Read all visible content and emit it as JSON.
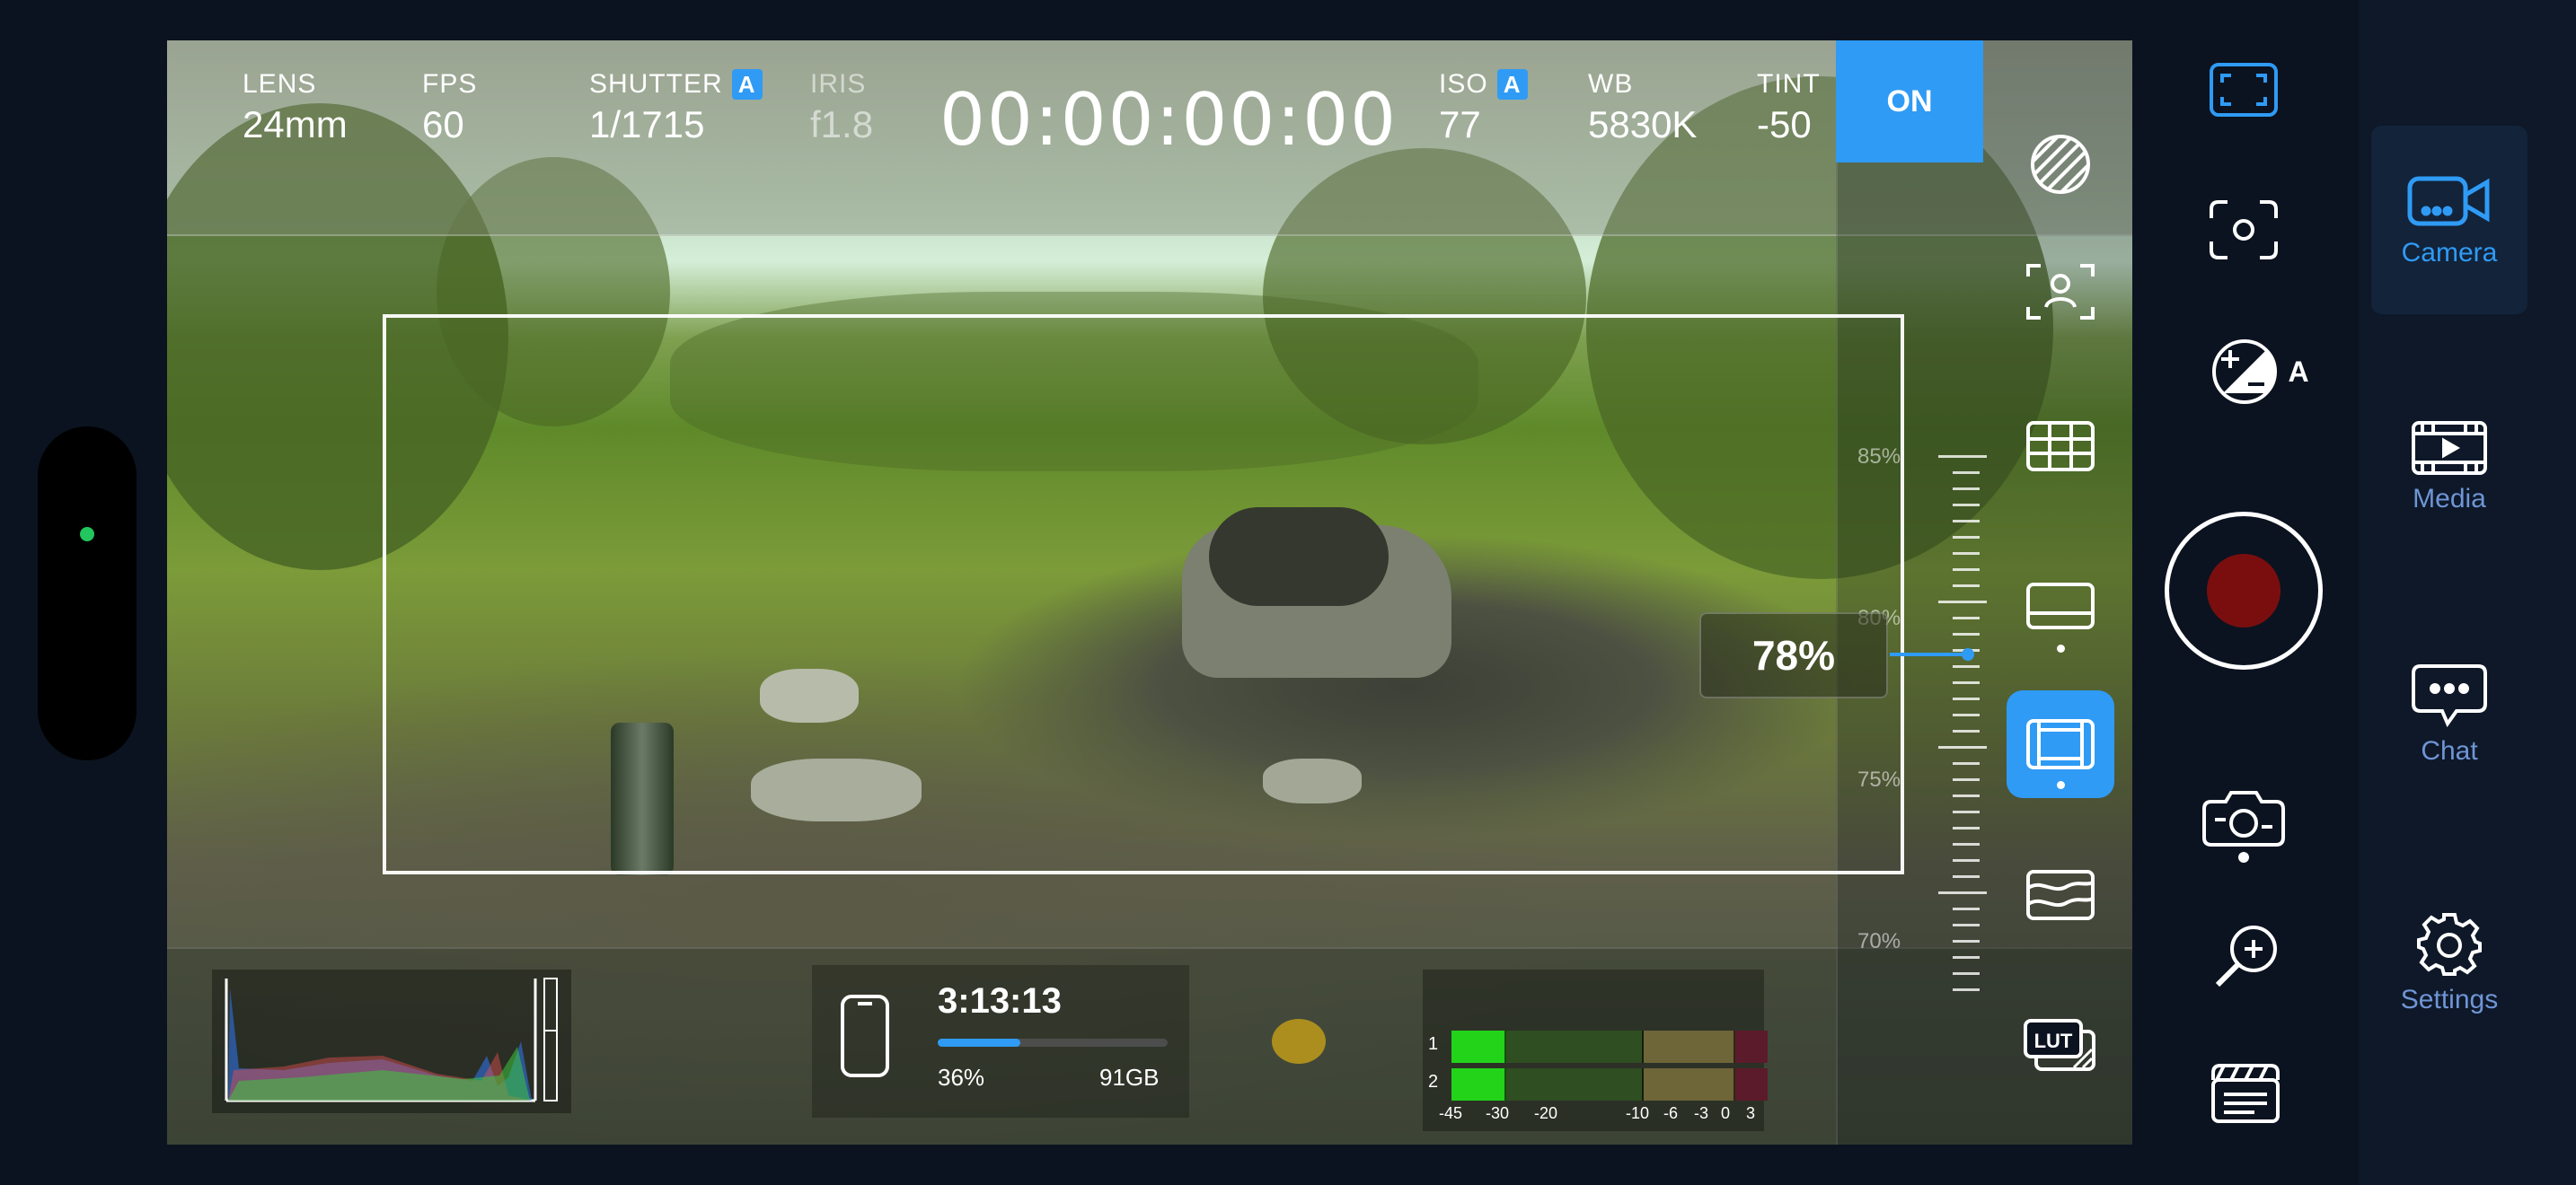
{
  "hud": {
    "lens": {
      "label": "LENS",
      "value": "24mm"
    },
    "fps": {
      "label": "FPS",
      "value": "60"
    },
    "shutter": {
      "label": "SHUTTER",
      "value": "1/1715",
      "auto": "A"
    },
    "iris": {
      "label": "IRIS",
      "value": "f1.8"
    },
    "timecode": "00:00:00:00",
    "iso": {
      "label": "ISO",
      "value": "77",
      "auto": "A"
    },
    "wb": {
      "label": "WB",
      "value": "5830K"
    },
    "tint": {
      "label": "TINT",
      "value": "-50"
    },
    "toggle": "ON"
  },
  "zoom": {
    "value_label": "78%",
    "value": 78,
    "ticks": [
      "85%",
      "80%",
      "75%",
      "70%"
    ]
  },
  "exposure_mode": "A",
  "storage": {
    "record_time": "3:13:13",
    "percent_label": "36%",
    "percent": 36,
    "capacity": "91GB"
  },
  "audio": {
    "channels": [
      "1",
      "2"
    ],
    "scale": [
      "-45",
      "-30",
      "-20",
      "-10",
      "-6",
      "-3",
      "0",
      "3"
    ]
  },
  "nav": {
    "camera": "Camera",
    "media": "Media",
    "chat": "Chat",
    "settings": "Settings"
  },
  "colors": {
    "accent": "#2f9bf5",
    "record": "#7a0e0e",
    "status": "#22c55e"
  }
}
